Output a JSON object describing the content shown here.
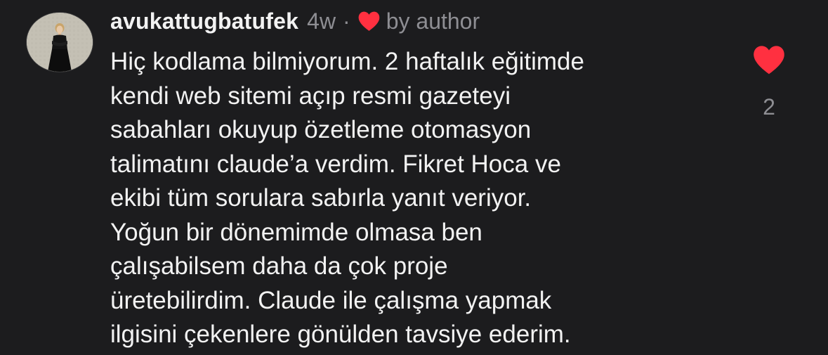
{
  "comment": {
    "username": "avukattugbatufek",
    "age": "4w",
    "separator": "·",
    "author_like_label": "by author",
    "body": "Hiç kodlama bilmiyorum. 2 haftalık eğitimde\nkendi web sitemi açıp resmi gazeteyi\nsabahları okuyup özetleme otomasyon\ntalimatını claude’a  verdim. Fikret Hoca ve\nekibi tüm sorulara sabırla yanıt veriyor.\nYoğun bir dönemimde olmasa ben\nçalışabilsem daha da çok proje\nüretebilirdim. Claude ile çalışma yapmak\nilgisini çekenlere gönülden tavsiye ederim.",
    "like_count": "2",
    "liked": true
  },
  "icons": {
    "avatar": "profile-photo",
    "author_like": "heart-icon",
    "like": "heart-icon"
  },
  "colors": {
    "background": "#1c1c1e",
    "text": "#f2f2f2",
    "secondary_text": "#8e8e93",
    "heart": "#ff3040"
  }
}
